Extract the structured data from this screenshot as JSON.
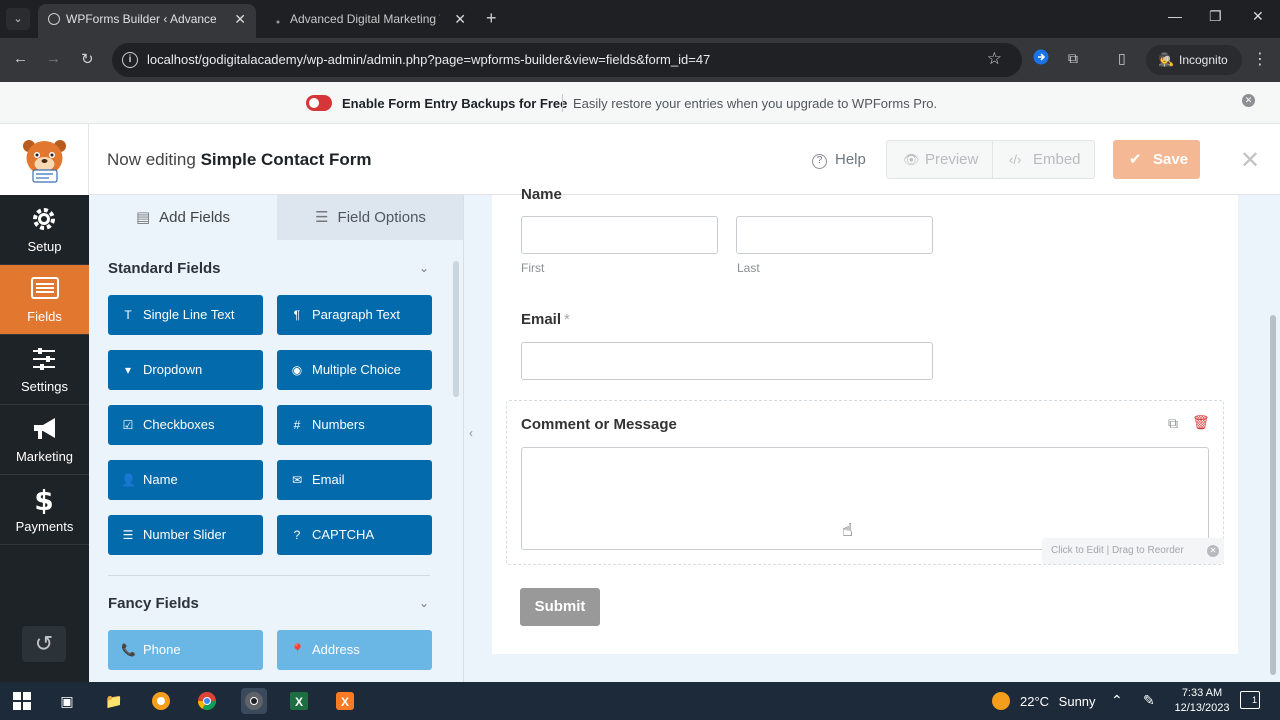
{
  "browser": {
    "tabs": [
      {
        "title": "WPForms Builder ‹ Advanced Di"
      },
      {
        "title": "Advanced Digital Marketing Tra"
      }
    ],
    "url": "localhost/godigitalacademy/wp-admin/admin.php?page=wpforms-builder&view=fields&form_id=47",
    "incognito_label": "Incognito"
  },
  "notice": {
    "bold_text": "Enable Form Entry Backups for Free",
    "text": "Easily restore your entries when you upgrade to WPForms Pro."
  },
  "header": {
    "editing_prefix": "Now editing",
    "form_name": "Simple Contact Form",
    "help_label": "Help",
    "preview_label": "Preview",
    "embed_label": "Embed",
    "save_label": "Save"
  },
  "leftnav": {
    "items": [
      {
        "label": "Setup",
        "icon": "gear-icon"
      },
      {
        "label": "Fields",
        "icon": "fields-icon"
      },
      {
        "label": "Settings",
        "icon": "sliders-icon"
      },
      {
        "label": "Marketing",
        "icon": "megaphone-icon"
      },
      {
        "label": "Payments",
        "icon": "dollar-icon"
      }
    ],
    "active": "Fields"
  },
  "panel": {
    "tabs": [
      {
        "label": "Add Fields"
      },
      {
        "label": "Field Options"
      }
    ],
    "standard_title": "Standard Fields",
    "standard_fields": [
      {
        "label": "Single Line Text",
        "icon": "T"
      },
      {
        "label": "Paragraph Text",
        "icon": "¶"
      },
      {
        "label": "Dropdown",
        "icon": "▾"
      },
      {
        "label": "Multiple Choice",
        "icon": "◉"
      },
      {
        "label": "Checkboxes",
        "icon": "☑"
      },
      {
        "label": "Numbers",
        "icon": "#"
      },
      {
        "label": "Name",
        "icon": "👤"
      },
      {
        "label": "Email",
        "icon": "✉"
      },
      {
        "label": "Number Slider",
        "icon": "☰"
      },
      {
        "label": "CAPTCHA",
        "icon": "?"
      }
    ],
    "fancy_title": "Fancy Fields",
    "fancy_fields": [
      {
        "label": "Phone",
        "icon": "📞"
      },
      {
        "label": "Address",
        "icon": "📍"
      }
    ]
  },
  "form": {
    "name_label": "Name",
    "first_label": "First",
    "last_label": "Last",
    "email_label": "Email",
    "required_mark": "*",
    "comment_label": "Comment or Message",
    "drag_tip": "Click to Edit | Drag to Reorder",
    "submit_label": "Submit"
  },
  "taskbar": {
    "weather_temp": "22°C",
    "weather_text": "Sunny",
    "time": "7:33 AM",
    "date": "12/13/2023",
    "notification_count": "1"
  }
}
